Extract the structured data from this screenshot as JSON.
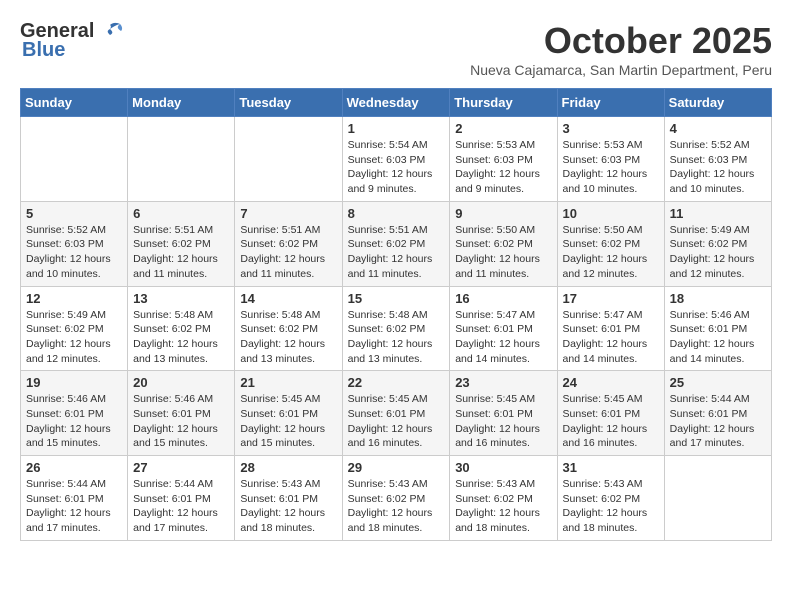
{
  "header": {
    "logo_general": "General",
    "logo_blue": "Blue",
    "month_title": "October 2025",
    "location": "Nueva Cajamarca, San Martin Department, Peru"
  },
  "weekdays": [
    "Sunday",
    "Monday",
    "Tuesday",
    "Wednesday",
    "Thursday",
    "Friday",
    "Saturday"
  ],
  "weeks": [
    [
      {
        "day": "",
        "info": ""
      },
      {
        "day": "",
        "info": ""
      },
      {
        "day": "",
        "info": ""
      },
      {
        "day": "1",
        "info": "Sunrise: 5:54 AM\nSunset: 6:03 PM\nDaylight: 12 hours and 9 minutes."
      },
      {
        "day": "2",
        "info": "Sunrise: 5:53 AM\nSunset: 6:03 PM\nDaylight: 12 hours and 9 minutes."
      },
      {
        "day": "3",
        "info": "Sunrise: 5:53 AM\nSunset: 6:03 PM\nDaylight: 12 hours and 10 minutes."
      },
      {
        "day": "4",
        "info": "Sunrise: 5:52 AM\nSunset: 6:03 PM\nDaylight: 12 hours and 10 minutes."
      }
    ],
    [
      {
        "day": "5",
        "info": "Sunrise: 5:52 AM\nSunset: 6:03 PM\nDaylight: 12 hours and 10 minutes."
      },
      {
        "day": "6",
        "info": "Sunrise: 5:51 AM\nSunset: 6:02 PM\nDaylight: 12 hours and 11 minutes."
      },
      {
        "day": "7",
        "info": "Sunrise: 5:51 AM\nSunset: 6:02 PM\nDaylight: 12 hours and 11 minutes."
      },
      {
        "day": "8",
        "info": "Sunrise: 5:51 AM\nSunset: 6:02 PM\nDaylight: 12 hours and 11 minutes."
      },
      {
        "day": "9",
        "info": "Sunrise: 5:50 AM\nSunset: 6:02 PM\nDaylight: 12 hours and 11 minutes."
      },
      {
        "day": "10",
        "info": "Sunrise: 5:50 AM\nSunset: 6:02 PM\nDaylight: 12 hours and 12 minutes."
      },
      {
        "day": "11",
        "info": "Sunrise: 5:49 AM\nSunset: 6:02 PM\nDaylight: 12 hours and 12 minutes."
      }
    ],
    [
      {
        "day": "12",
        "info": "Sunrise: 5:49 AM\nSunset: 6:02 PM\nDaylight: 12 hours and 12 minutes."
      },
      {
        "day": "13",
        "info": "Sunrise: 5:48 AM\nSunset: 6:02 PM\nDaylight: 12 hours and 13 minutes."
      },
      {
        "day": "14",
        "info": "Sunrise: 5:48 AM\nSunset: 6:02 PM\nDaylight: 12 hours and 13 minutes."
      },
      {
        "day": "15",
        "info": "Sunrise: 5:48 AM\nSunset: 6:02 PM\nDaylight: 12 hours and 13 minutes."
      },
      {
        "day": "16",
        "info": "Sunrise: 5:47 AM\nSunset: 6:01 PM\nDaylight: 12 hours and 14 minutes."
      },
      {
        "day": "17",
        "info": "Sunrise: 5:47 AM\nSunset: 6:01 PM\nDaylight: 12 hours and 14 minutes."
      },
      {
        "day": "18",
        "info": "Sunrise: 5:46 AM\nSunset: 6:01 PM\nDaylight: 12 hours and 14 minutes."
      }
    ],
    [
      {
        "day": "19",
        "info": "Sunrise: 5:46 AM\nSunset: 6:01 PM\nDaylight: 12 hours and 15 minutes."
      },
      {
        "day": "20",
        "info": "Sunrise: 5:46 AM\nSunset: 6:01 PM\nDaylight: 12 hours and 15 minutes."
      },
      {
        "day": "21",
        "info": "Sunrise: 5:45 AM\nSunset: 6:01 PM\nDaylight: 12 hours and 15 minutes."
      },
      {
        "day": "22",
        "info": "Sunrise: 5:45 AM\nSunset: 6:01 PM\nDaylight: 12 hours and 16 minutes."
      },
      {
        "day": "23",
        "info": "Sunrise: 5:45 AM\nSunset: 6:01 PM\nDaylight: 12 hours and 16 minutes."
      },
      {
        "day": "24",
        "info": "Sunrise: 5:45 AM\nSunset: 6:01 PM\nDaylight: 12 hours and 16 minutes."
      },
      {
        "day": "25",
        "info": "Sunrise: 5:44 AM\nSunset: 6:01 PM\nDaylight: 12 hours and 17 minutes."
      }
    ],
    [
      {
        "day": "26",
        "info": "Sunrise: 5:44 AM\nSunset: 6:01 PM\nDaylight: 12 hours and 17 minutes."
      },
      {
        "day": "27",
        "info": "Sunrise: 5:44 AM\nSunset: 6:01 PM\nDaylight: 12 hours and 17 minutes."
      },
      {
        "day": "28",
        "info": "Sunrise: 5:43 AM\nSunset: 6:01 PM\nDaylight: 12 hours and 18 minutes."
      },
      {
        "day": "29",
        "info": "Sunrise: 5:43 AM\nSunset: 6:02 PM\nDaylight: 12 hours and 18 minutes."
      },
      {
        "day": "30",
        "info": "Sunrise: 5:43 AM\nSunset: 6:02 PM\nDaylight: 12 hours and 18 minutes."
      },
      {
        "day": "31",
        "info": "Sunrise: 5:43 AM\nSunset: 6:02 PM\nDaylight: 12 hours and 18 minutes."
      },
      {
        "day": "",
        "info": ""
      }
    ]
  ]
}
